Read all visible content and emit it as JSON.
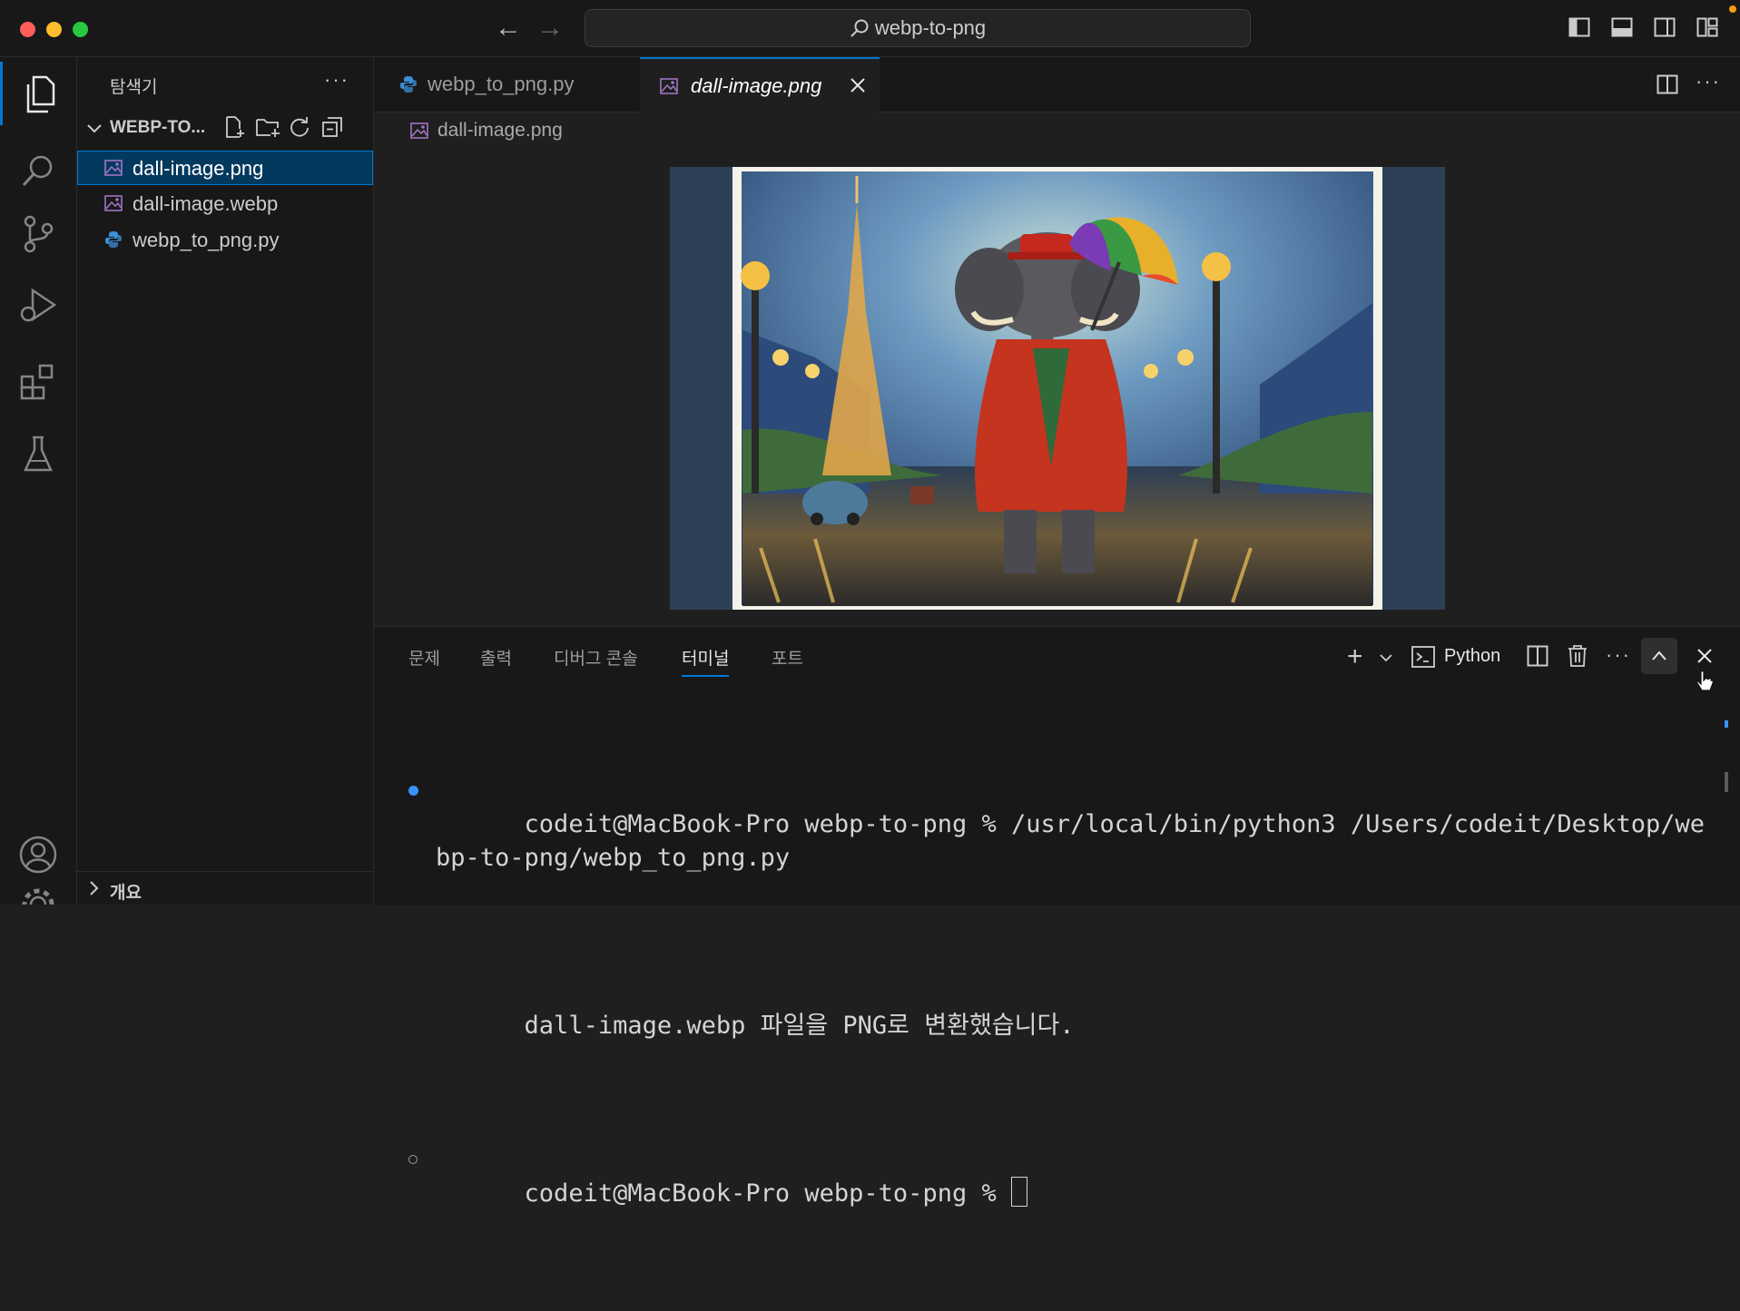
{
  "window": {
    "title": "webp-to-png",
    "colors": {
      "close": "#ff5f57",
      "minimize": "#febc2e",
      "maximize": "#28c840",
      "accent": "#0078d4"
    }
  },
  "sidebar": {
    "title": "탐색기",
    "more": "···",
    "folder": "WEBP-TO...",
    "files": [
      {
        "name": "dall-image.png",
        "icon": "image-icon"
      },
      {
        "name": "dall-image.webp",
        "icon": "image-icon"
      },
      {
        "name": "webp_to_png.py",
        "icon": "python-icon"
      }
    ],
    "outline": "개요"
  },
  "tabs": [
    {
      "label": "webp_to_png.py",
      "icon": "python-icon",
      "active": false
    },
    {
      "label": "dall-image.png",
      "icon": "image-icon",
      "active": true
    }
  ],
  "editor": {
    "breadcrumb": "dall-image.png"
  },
  "panel": {
    "tabs": [
      "문제",
      "출력",
      "디버그 콘솔",
      "터미널",
      "포트"
    ],
    "active_tab": "터미널",
    "terminal_profile": "Python",
    "lines": [
      "codeit@MacBook-Pro webp-to-png % /usr/local/bin/python3 /Users/codeit/Desktop/webp-to-png/webp_to_png.py",
      "dall-image.webp 파일을 PNG로 변환했습니다.",
      "codeit@MacBook-Pro webp-to-png % "
    ]
  }
}
